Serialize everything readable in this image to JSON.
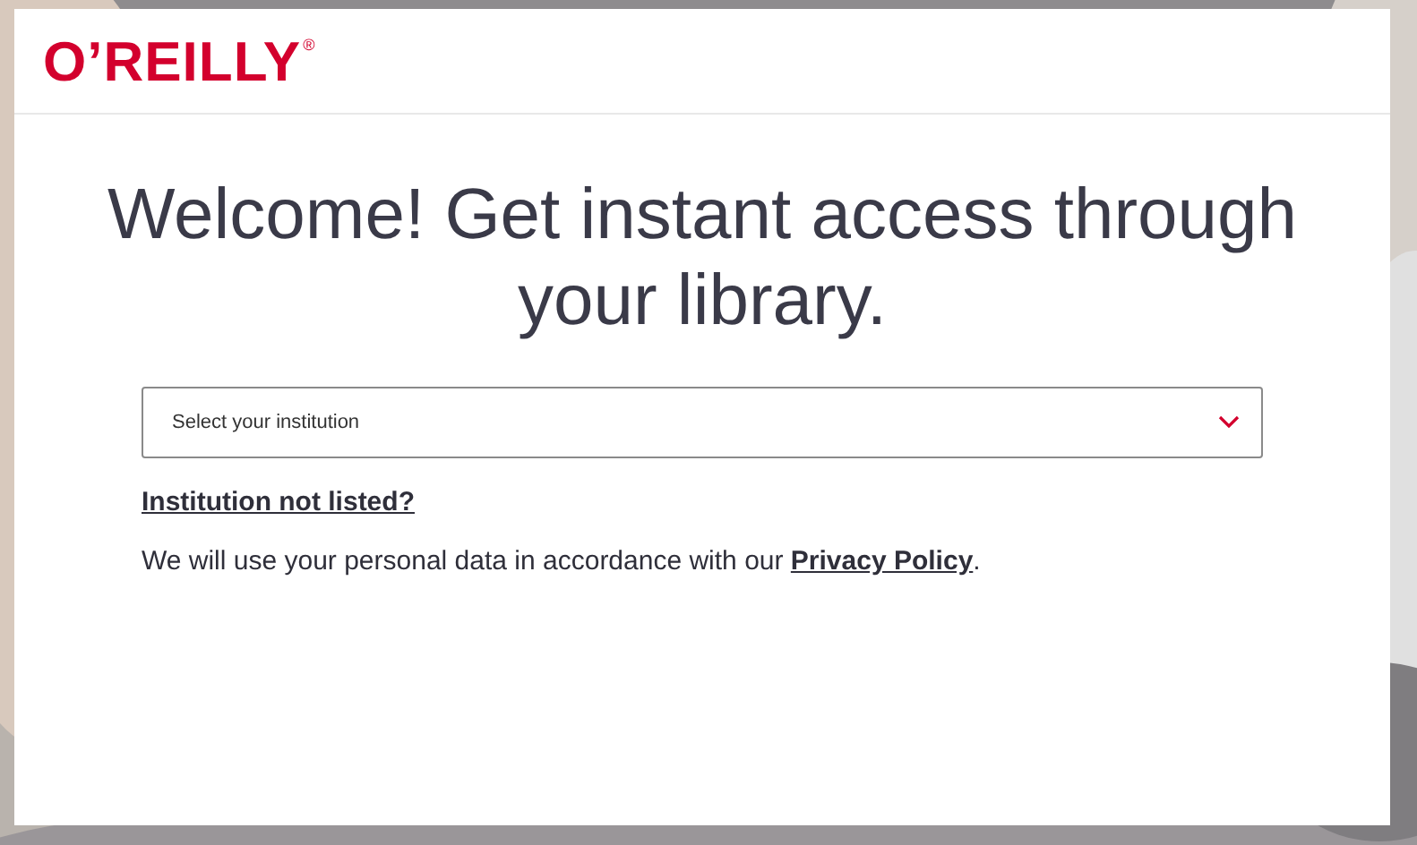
{
  "logo": {
    "text": "O’REILLY",
    "mark": "®"
  },
  "heading": "Welcome! Get instant access through your library.",
  "institution_select": {
    "placeholder": "Select your institution",
    "expanded": false
  },
  "not_listed_link": "Institution not listed?",
  "notice": {
    "text": "We will use your personal data in accordance with our ",
    "link": "Privacy Policy",
    "end": "."
  }
}
